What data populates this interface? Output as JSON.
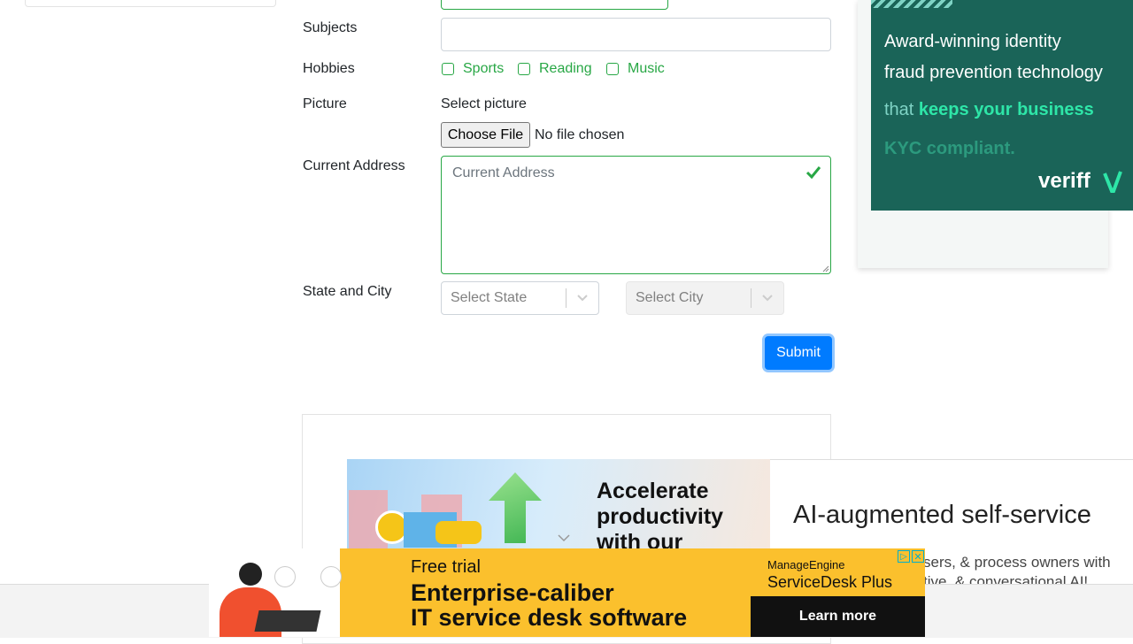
{
  "form": {
    "subjects_label": "Subjects",
    "hobbies_label": "Hobbies",
    "hobbies": [
      "Sports",
      "Reading",
      "Music"
    ],
    "picture_label": "Picture",
    "select_picture": "Select picture",
    "choose_file": "Choose File",
    "no_file": "No file chosen",
    "address_label": "Current Address",
    "address_placeholder": "Current Address",
    "state_city_label": "State and City",
    "state_placeholder": "Select State",
    "city_placeholder": "Select City",
    "submit": "Submit"
  },
  "ad_right": {
    "line1": "Award-winning identity",
    "line2": "fraud prevention technology",
    "line3_prefix": "that ",
    "line3_highlight": "keeps your business",
    "line4": "KYC compliant.",
    "brand": "veriff",
    "accent": "#2ee6a8"
  },
  "ad_mid": {
    "headline1": "Accelerate",
    "headline2": "productivity",
    "headline3": "with our",
    "tagline": "AI-augmented self-service",
    "sub1": "sers, & process owners with",
    "sub2": "tive, & conversational AI!"
  },
  "ad_bottom": {
    "free_trial": "Free trial",
    "line1": "Enterprise-caliber",
    "line2": "IT service desk software",
    "brand1": "ManageEngine",
    "brand2": "ServiceDesk Plus",
    "cta": "Learn more",
    "bg": "#fbc02d"
  },
  "colors": {
    "primary": "#007bff",
    "valid": "#28a745"
  }
}
